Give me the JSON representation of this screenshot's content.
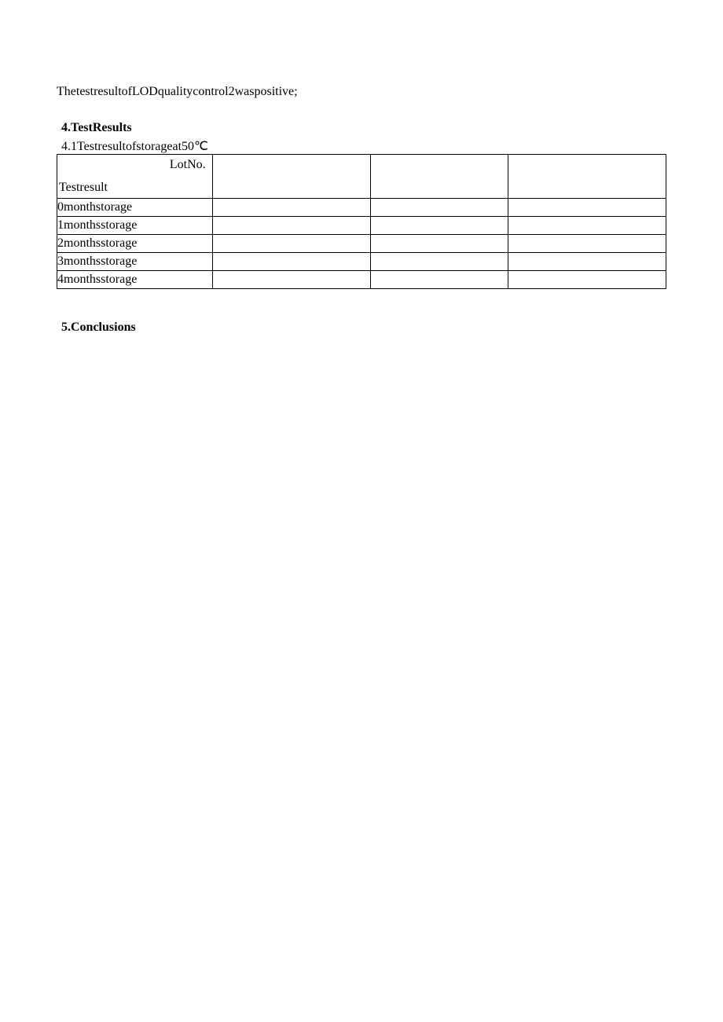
{
  "intro_line": "ThetestresultofLODqualitycontrol2waspositive;",
  "sections": {
    "results_heading": "4.TestResults",
    "results_subheading": "4.1Testresultofstorageat50℃",
    "conclusions_heading": "5.Conclusions"
  },
  "table": {
    "header": {
      "top_right": "LotNo.",
      "bottom_left": "Testresult"
    },
    "rows": [
      {
        "label": "0monthstorage",
        "c1": "",
        "c2": "",
        "c3": ""
      },
      {
        "label": "1monthsstorage",
        "c1": "",
        "c2": "",
        "c3": ""
      },
      {
        "label": "2monthsstorage",
        "c1": "",
        "c2": "",
        "c3": ""
      },
      {
        "label": "3monthsstorage",
        "c1": "",
        "c2": "",
        "c3": ""
      },
      {
        "label": "4monthsstorage",
        "c1": "",
        "c2": "",
        "c3": ""
      }
    ]
  }
}
